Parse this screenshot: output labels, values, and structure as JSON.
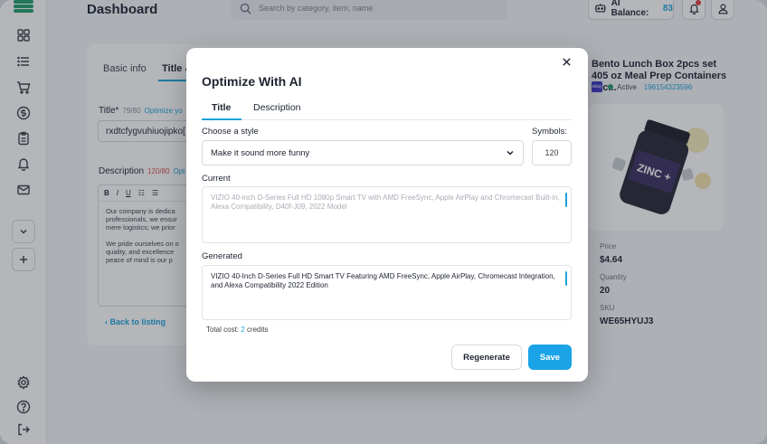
{
  "header": {
    "title": "Dashboard",
    "search_placeholder": "Search by category, item, name",
    "ai_balance_label": "AI Balance:",
    "ai_balance_value": "83"
  },
  "sidebar": {
    "items": [
      {
        "icon": "grid-icon"
      },
      {
        "icon": "list-icon"
      },
      {
        "icon": "cart-icon"
      },
      {
        "icon": "dollar-icon"
      },
      {
        "icon": "clipboard-icon"
      },
      {
        "icon": "bell-icon"
      },
      {
        "icon": "mail-icon"
      }
    ],
    "bottom": [
      {
        "icon": "settings-icon"
      },
      {
        "icon": "help-icon"
      },
      {
        "icon": "logout-icon"
      }
    ]
  },
  "editor": {
    "tabs": [
      "Basic info",
      "Title &"
    ],
    "title_label": "Title*",
    "title_count": "79/80",
    "title_link": "Optimize yo",
    "title_value": "rxdtcfygvuhiuojipko[",
    "desc_label": "Description",
    "desc_count": "120/80",
    "desc_link": "Opt",
    "toolbar": [
      "B",
      "I",
      "U",
      "☷",
      "☰"
    ],
    "desc_text": "Our company is dedica\nprofessionals, we ensur\nmere logistics; we prior\n\nWe pride ourselves on o\nquality, and excellence\npeace of mind is our p",
    "back_link": "Back to listing"
  },
  "product": {
    "title": "Bento Lunch Box 2pcs set 405 oz Meal Prep Containers Mic...",
    "badge": "ebay",
    "status": "Active",
    "id": "196154323596",
    "image_label": "ZINC +",
    "price_label": "Price",
    "price_value": "$4.64",
    "quantity_label": "Quantity",
    "quantity_value": "20",
    "sku_label": "SKU",
    "sku_value": "WE65HYUJ3"
  },
  "modal": {
    "title": "Optimize With AI",
    "tabs": [
      "Title",
      "Description"
    ],
    "style_label": "Choose a style",
    "style_value": "Make it sound more funny",
    "symbols_label": "Symbols:",
    "symbols_value": "120",
    "current_label": "Current",
    "current_text": "VIZIO 40-inch D-Series Full HD 1080p Smart TV with AMD FreeSync, Apple AirPlay and Chromecast Built-in, Alexa Compatibility, D40f-J09, 2022 Model",
    "generated_label": "Generated",
    "generated_text": "VIZIO 40-Inch D-Series Full HD Smart TV Featuring AMD FreeSync, Apple AirPlay, Chromecast Integration, and Alexa Compatibility 2022 Edition",
    "cost_prefix": "Total cost:",
    "cost_value": "2",
    "cost_suffix": "credits",
    "regenerate": "Regenerate",
    "save": "Save"
  },
  "colors": {
    "accent": "#1aa3d9",
    "brand": "#1f9d6b",
    "save_button": "#1aa3e6"
  }
}
